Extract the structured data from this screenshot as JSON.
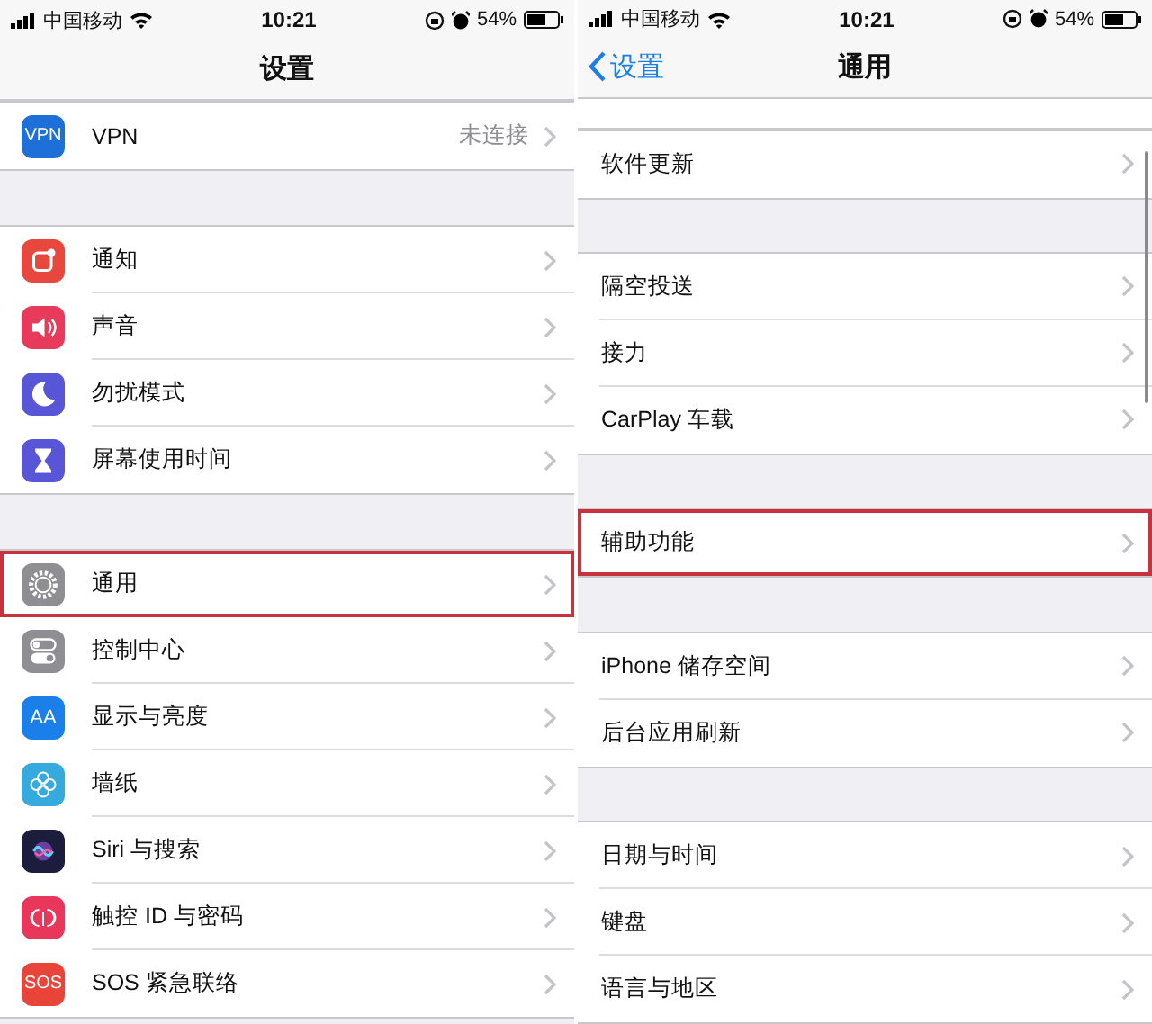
{
  "panels": [
    {
      "status_bar": {
        "carrier": "中国移动",
        "time": "10:21",
        "battery": "54%"
      },
      "nav": {
        "title": "设置"
      },
      "groups": [
        {
          "rows": [
            {
              "label": "VPN",
              "icon_text": "VPN",
              "value": "未连接",
              "highlighted": false
            }
          ]
        },
        {
          "rows": [
            {
              "label": "通知",
              "highlighted": false
            },
            {
              "label": "声音",
              "highlighted": false
            },
            {
              "label": "勿扰模式",
              "highlighted": false
            },
            {
              "label": "屏幕使用时间",
              "highlighted": false
            }
          ]
        },
        {
          "rows": [
            {
              "label": "通用",
              "highlighted": true
            },
            {
              "label": "控制中心",
              "highlighted": false
            },
            {
              "label": "显示与亮度",
              "icon_text": "AA",
              "highlighted": false
            },
            {
              "label": "墙纸",
              "highlighted": false
            },
            {
              "label": "Siri 与搜索",
              "highlighted": false
            },
            {
              "label": "触控 ID 与密码",
              "highlighted": false
            },
            {
              "label": "SOS 紧急联络",
              "icon_text": "SOS",
              "highlighted": false
            }
          ]
        }
      ]
    },
    {
      "status_bar": {
        "carrier": "中国移动",
        "time": "10:21",
        "battery": "54%"
      },
      "nav": {
        "back": "设置",
        "title": "通用"
      },
      "partial_top_row": true,
      "groups": [
        {
          "rows": [
            {
              "label": "软件更新",
              "highlighted": false
            }
          ]
        },
        {
          "rows": [
            {
              "label": "隔空投送",
              "highlighted": false
            },
            {
              "label": "接力",
              "highlighted": false
            },
            {
              "label": "CarPlay 车载",
              "highlighted": false
            }
          ]
        },
        {
          "rows": [
            {
              "label": "辅助功能",
              "highlighted": true
            }
          ]
        },
        {
          "rows": [
            {
              "label": "iPhone 储存空间",
              "highlighted": false
            },
            {
              "label": "后台应用刷新",
              "highlighted": false
            }
          ]
        },
        {
          "rows": [
            {
              "label": "日期与时间",
              "highlighted": false
            },
            {
              "label": "键盘",
              "highlighted": false
            },
            {
              "label": "语言与地区",
              "highlighted": false
            }
          ]
        }
      ]
    }
  ]
}
